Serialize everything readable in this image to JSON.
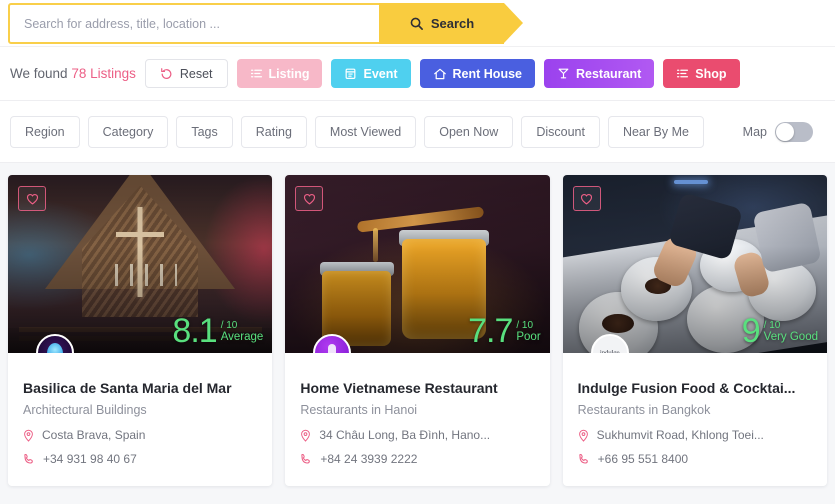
{
  "search": {
    "placeholder": "Search for address, title, location ...",
    "value": "",
    "button_label": "Search",
    "icon": "search-icon"
  },
  "results": {
    "found_prefix": "We found",
    "found_count": "78 Listings",
    "reset_label": "Reset",
    "reset_icon": "reset-arrow-icon",
    "types": [
      {
        "label": "Listing",
        "icon": "list-icon",
        "color": "#f7b8c8",
        "text_color": "#ffffff"
      },
      {
        "label": "Event",
        "icon": "calendar-icon",
        "color": "#4fd0ef",
        "text_color": "#ffffff"
      },
      {
        "label": "Rent House",
        "icon": "home-icon",
        "color": "#4a5fe0",
        "text_color": "#ffffff"
      },
      {
        "label": "Restaurant",
        "icon": "cocktail-icon",
        "color": "#a246ee",
        "text_color": "#ffffff"
      },
      {
        "label": "Shop",
        "icon": "list-alt-icon",
        "color": "#ea4c6f",
        "text_color": "#ffffff"
      }
    ]
  },
  "filters": {
    "chips": [
      "Region",
      "Category",
      "Tags",
      "Rating",
      "Most Viewed",
      "Open Now",
      "Discount",
      "Near By Me"
    ],
    "map_label": "Map",
    "map_enabled": false
  },
  "cards": [
    {
      "photo": "church-interior",
      "favorite_icon": "heart-icon",
      "rating": {
        "score": "8.1",
        "out_of": "/ 10",
        "word": "Average",
        "color": "#59e07e"
      },
      "avatar": {
        "type": "church-logo",
        "text": ""
      },
      "title": "Basilica de Santa Maria del Mar",
      "category": "Architectural Buildings",
      "address": "Costa Brava, Spain",
      "phone": "+34 931 98 40 67"
    },
    {
      "photo": "honey-jars",
      "favorite_icon": "heart-icon",
      "rating": {
        "score": "7.7",
        "out_of": "/ 10",
        "word": "Poor",
        "color": "#59e07e"
      },
      "avatar": {
        "type": "purple-logo",
        "text": ""
      },
      "title": "Home Vietnamese Restaurant",
      "category": "Restaurants in Hanoi",
      "address": "34 Châu Long, Ba Đình, Hano...",
      "phone": "+84 24 3939 2222"
    },
    {
      "photo": "chef-plating",
      "favorite_icon": "heart-icon",
      "rating": {
        "score": "9",
        "out_of": "/ 10",
        "word": "Very Good",
        "color": "#59e07e"
      },
      "avatar": {
        "type": "indulge-logo",
        "text": "indulge"
      },
      "title": "Indulge Fusion Food & Cocktai...",
      "category": "Restaurants in Bangkok",
      "address": "Sukhumvit Road, Khlong Toei...",
      "phone": "+66 95 551 8400"
    }
  ],
  "icons": {
    "location_pin": "map-pin-icon",
    "phone": "phone-icon"
  },
  "colors": {
    "accent_yellow": "#f9cc3f",
    "accent_pink": "#ec5f86",
    "rating_green": "#59e07e",
    "page_bg": "#f6f7f9"
  }
}
